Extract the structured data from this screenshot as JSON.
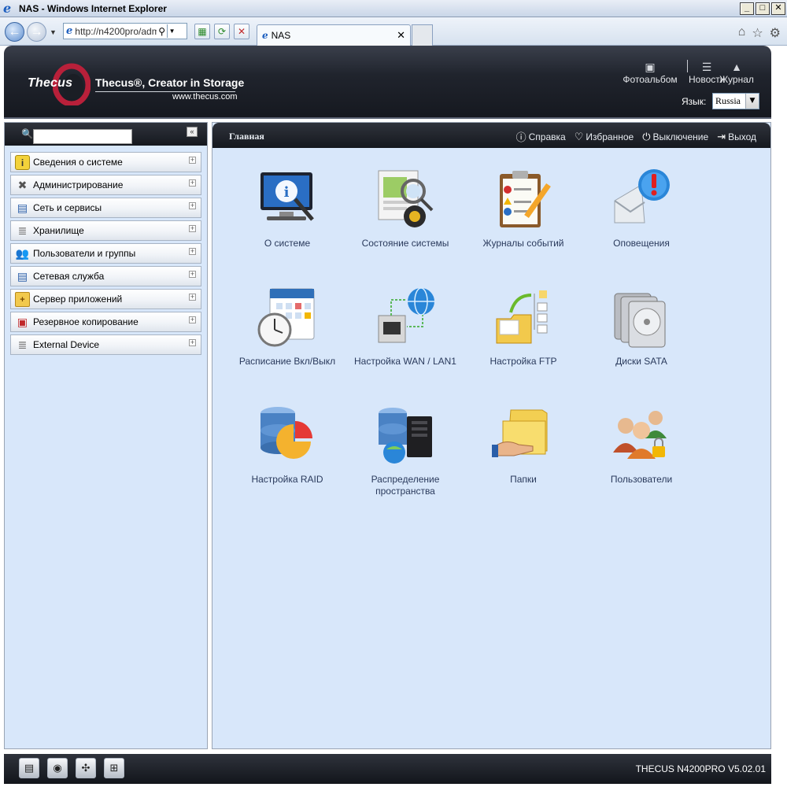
{
  "window": {
    "title": "NAS - Windows Internet Explorer",
    "address": "http://n4200pro/adm",
    "tab_label": "NAS"
  },
  "header": {
    "logo_text": "Thecus",
    "slogan": "Thecus®, Creator in Storage",
    "site_url": "www.thecus.com",
    "links": {
      "album": "Фотоальбом",
      "news": "Новости",
      "log": "Журнал"
    },
    "language_label": "Язык:",
    "language_value": "Russia"
  },
  "sidebar": {
    "items": [
      {
        "label": "Сведения о системе",
        "icon": "info-icon"
      },
      {
        "label": "Администрирование",
        "icon": "tools-icon"
      },
      {
        "label": "Сеть и сервисы",
        "icon": "network-icon"
      },
      {
        "label": "Хранилище",
        "icon": "storage-icon"
      },
      {
        "label": "Пользователи и группы",
        "icon": "users-icon"
      },
      {
        "label": "Сетевая служба",
        "icon": "network-service-icon"
      },
      {
        "label": "Сервер приложений",
        "icon": "folder-app-icon"
      },
      {
        "label": "Резервное копирование",
        "icon": "backup-icon"
      },
      {
        "label": "External Device",
        "icon": "external-device-icon"
      }
    ]
  },
  "main": {
    "breadcrumb": "Главная",
    "toolbar": {
      "help": "Справка",
      "favorites": "Избранное",
      "shutdown": "Выключение",
      "logout": "Выход"
    },
    "tiles": [
      {
        "label": "О системе",
        "icon": "system-info-icon"
      },
      {
        "label": "Состояние системы",
        "icon": "system-status-icon"
      },
      {
        "label": "Журналы событий",
        "icon": "event-log-icon"
      },
      {
        "label": "Оповещения",
        "icon": "notification-icon"
      },
      {
        "label": "Расписание Вкл/Выкл",
        "icon": "schedule-icon"
      },
      {
        "label": "Настройка WAN / LAN1",
        "icon": "wan-lan-icon"
      },
      {
        "label": "Настройка FTP",
        "icon": "ftp-icon"
      },
      {
        "label": "Диски SATA",
        "icon": "sata-disks-icon"
      },
      {
        "label": "Настройка RAID",
        "icon": "raid-icon"
      },
      {
        "label": "Распределение\nпространства",
        "icon": "space-allocation-icon"
      },
      {
        "label": "Папки",
        "icon": "folders-icon"
      },
      {
        "label": "Пользователи",
        "icon": "users-tile-icon"
      }
    ]
  },
  "footer": {
    "version": "THECUS N4200PRO V5.02.01",
    "buttons": [
      "raid-status-icon",
      "disk-status-icon",
      "fan-status-icon",
      "network-status-icon"
    ]
  }
}
